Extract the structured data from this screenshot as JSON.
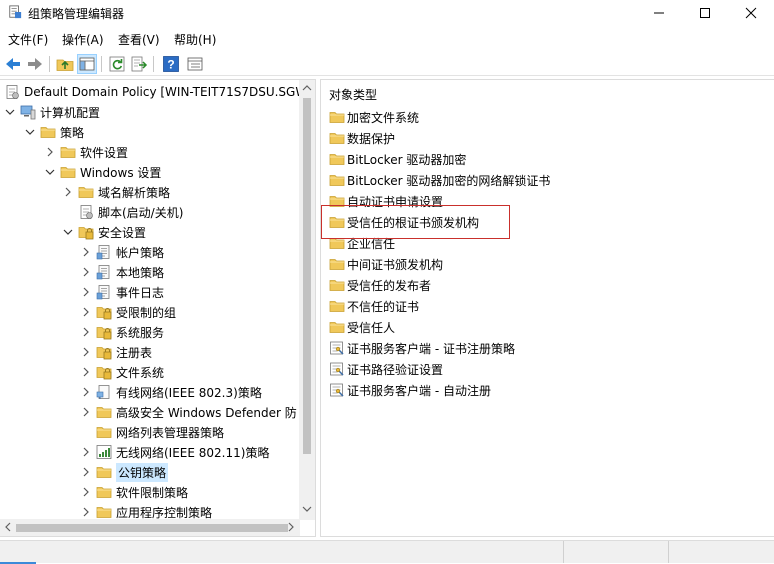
{
  "window": {
    "title": "组策略管理编辑器"
  },
  "menu": [
    {
      "id": "file",
      "label": "文件(F)"
    },
    {
      "id": "action",
      "label": "操作(A)"
    },
    {
      "id": "view",
      "label": "查看(V)"
    },
    {
      "id": "help",
      "label": "帮助(H)"
    }
  ],
  "tree": {
    "root": "Default Domain Policy [WIN-TEIT71S7DSU.SGW",
    "computer_config": "计算机配置",
    "policies": "策略",
    "software_settings": "软件设置",
    "windows_settings": "Windows 设置",
    "name_resolution_policy": "域名解析策略",
    "scripts": "脚本(启动/关机)",
    "security_settings": "安全设置",
    "account_policies": "帐户策略",
    "local_policies": "本地策略",
    "event_log": "事件日志",
    "restricted_groups": "受限制的组",
    "system_services": "系统服务",
    "registry": "注册表",
    "file_system": "文件系统",
    "wired_network": "有线网络(IEEE 802.3)策略",
    "advanced_firewall": "高级安全 Windows Defender 防",
    "network_list_manager": "网络列表管理器策略",
    "wireless_network": "无线网络(IEEE 802.11)策略",
    "public_key_policies": "公钥策略",
    "software_restriction": "软件限制策略",
    "app_control": "应用程序控制策略"
  },
  "list": {
    "column_header": "对象类型",
    "items": [
      {
        "label": "加密文件系统",
        "icon": "folder"
      },
      {
        "label": "数据保护",
        "icon": "folder"
      },
      {
        "label": "BitLocker 驱动器加密",
        "icon": "folder"
      },
      {
        "label": "BitLocker 驱动器加密的网络解锁证书",
        "icon": "folder"
      },
      {
        "label": "自动证书申请设置",
        "icon": "folder"
      },
      {
        "label": "受信任的根证书颁发机构",
        "icon": "folder"
      },
      {
        "label": "企业信任",
        "icon": "folder"
      },
      {
        "label": "中间证书颁发机构",
        "icon": "folder"
      },
      {
        "label": "受信任的发布者",
        "icon": "folder"
      },
      {
        "label": "不信任的证书",
        "icon": "folder"
      },
      {
        "label": "受信任人",
        "icon": "folder"
      },
      {
        "label": "证书服务客户端 - 证书注册策略",
        "icon": "setting"
      },
      {
        "label": "证书路径验证设置",
        "icon": "setting"
      },
      {
        "label": "证书服务客户端 - 自动注册",
        "icon": "setting"
      }
    ]
  },
  "colors": {
    "selection": "#cce8ff",
    "highlight_border": "#c9302c",
    "folder": "#f0c85a",
    "toolbar_arrow": "#2b7fd4"
  }
}
